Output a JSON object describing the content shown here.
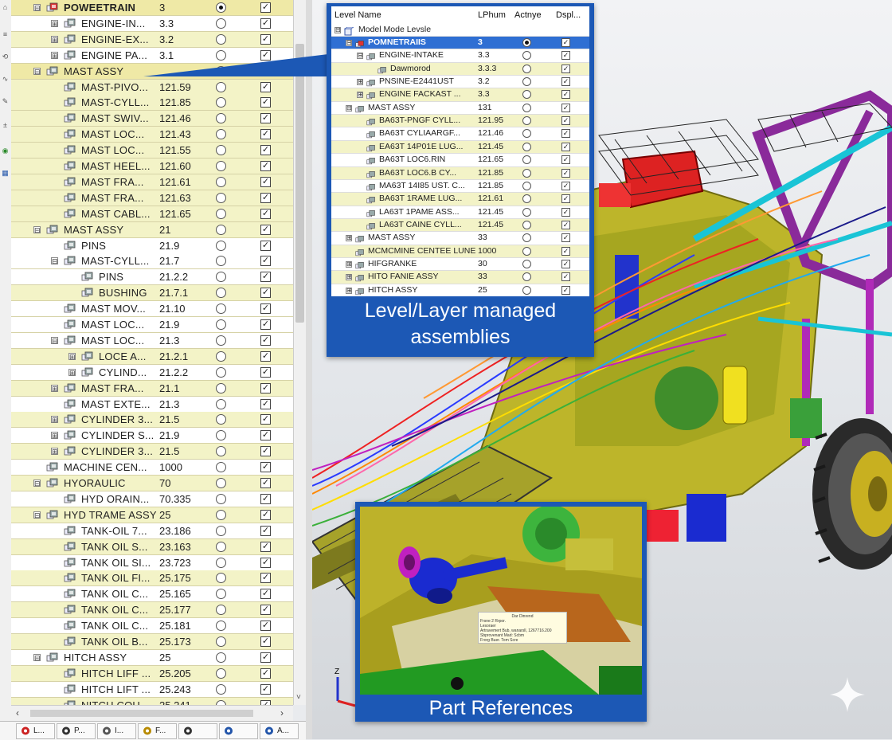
{
  "tree": {
    "rows": [
      {
        "name": "POWEETRAIN",
        "value": "3",
        "indent": 0,
        "toggle": "⊟",
        "active": true,
        "bold": true,
        "style": "top",
        "icon": "assembly-red-icon"
      },
      {
        "name": "ENGINE-IN...",
        "value": "3.3",
        "indent": 1,
        "toggle": "⊞",
        "active": false,
        "style": "nohl",
        "icon": "part-icon"
      },
      {
        "name": "ENGINE-EX...",
        "value": "3.2",
        "indent": 1,
        "toggle": "⊞",
        "active": false,
        "style": "hl",
        "icon": "part-icon"
      },
      {
        "name": "ENGINE PA...",
        "value": "3.1",
        "indent": 1,
        "toggle": "⊞",
        "active": false,
        "style": "nohl",
        "icon": "part-icon"
      },
      {
        "name": "MAST ASSY",
        "value": "",
        "indent": 0,
        "toggle": "⊟",
        "active": false,
        "style": "top",
        "icon": "part-icon"
      },
      {
        "name": "MAST-PIVO...",
        "value": "121.59",
        "indent": 1,
        "toggle": "",
        "active": false,
        "style": "hl",
        "icon": "part-icon"
      },
      {
        "name": "MAST-CYLL...",
        "value": "121.85",
        "indent": 1,
        "toggle": "",
        "active": false,
        "style": "hl",
        "icon": "part-icon"
      },
      {
        "name": "MAST SWIV...",
        "value": "121.46",
        "indent": 1,
        "toggle": "",
        "active": false,
        "style": "hl",
        "icon": "part-icon"
      },
      {
        "name": "MAST LOC...",
        "value": "121.43",
        "indent": 1,
        "toggle": "",
        "active": false,
        "style": "hl",
        "icon": "part-icon"
      },
      {
        "name": "MAST LOC...",
        "value": "121.55",
        "indent": 1,
        "toggle": "",
        "active": false,
        "style": "hl",
        "icon": "part-icon"
      },
      {
        "name": "MAST HEEL...",
        "value": "121.60",
        "indent": 1,
        "toggle": "",
        "active": false,
        "style": "hl",
        "icon": "part-icon"
      },
      {
        "name": "MAST FRA...",
        "value": "121.61",
        "indent": 1,
        "toggle": "",
        "active": false,
        "style": "hl",
        "icon": "part-icon"
      },
      {
        "name": "MAST FRA...",
        "value": "121.63",
        "indent": 1,
        "toggle": "",
        "active": false,
        "style": "hl",
        "icon": "part-icon"
      },
      {
        "name": "MAST CABL...",
        "value": "121.65",
        "indent": 1,
        "toggle": "",
        "active": false,
        "style": "hl",
        "icon": "part-icon"
      },
      {
        "name": "MAST ASSY",
        "value": "21",
        "indent": 0,
        "toggle": "⊟",
        "active": false,
        "style": "hl",
        "icon": "part-icon"
      },
      {
        "name": "PINS",
        "value": "21.9",
        "indent": 1,
        "toggle": "",
        "active": false,
        "style": "nohl",
        "icon": "part-icon"
      },
      {
        "name": "MAST-CYLL...",
        "value": "21.7",
        "indent": 1,
        "toggle": "⊟",
        "active": false,
        "style": "nohl",
        "icon": "part-icon"
      },
      {
        "name": "PINS",
        "value": "21.2.2",
        "indent": 2,
        "toggle": "",
        "active": false,
        "style": "nohl",
        "icon": "part-icon"
      },
      {
        "name": "BUSHING",
        "value": "21.7.1",
        "indent": 2,
        "toggle": "",
        "active": false,
        "style": "hl",
        "icon": "part-icon"
      },
      {
        "name": "MAST MOV...",
        "value": "21.10",
        "indent": 1,
        "toggle": "",
        "active": false,
        "style": "nohl",
        "icon": "part-icon"
      },
      {
        "name": "MAST LOC...",
        "value": "21.9",
        "indent": 1,
        "toggle": "",
        "active": false,
        "style": "nohl",
        "icon": "part-icon"
      },
      {
        "name": "MAST LOC...",
        "value": "21.3",
        "indent": 1,
        "toggle": "⊟",
        "active": false,
        "style": "nohl",
        "icon": "part-icon"
      },
      {
        "name": "LOCE A...",
        "value": "21.2.1",
        "indent": 2,
        "toggle": "⊞",
        "active": false,
        "style": "hl",
        "icon": "part-icon"
      },
      {
        "name": "CYLIND...",
        "value": "21.2.2",
        "indent": 2,
        "toggle": "⊞",
        "active": false,
        "style": "nohl",
        "icon": "part-icon"
      },
      {
        "name": "MAST FRA...",
        "value": "21.1",
        "indent": 1,
        "toggle": "⊞",
        "active": false,
        "style": "hl",
        "icon": "part-icon"
      },
      {
        "name": "MAST EXTE...",
        "value": "21.3",
        "indent": 1,
        "toggle": "",
        "active": false,
        "style": "nohl",
        "icon": "part-icon"
      },
      {
        "name": "CYLINDER 3...",
        "value": "21.5",
        "indent": 1,
        "toggle": "⊞",
        "active": false,
        "style": "hl",
        "icon": "part-icon"
      },
      {
        "name": "CYLINDER S...",
        "value": "21.9",
        "indent": 1,
        "toggle": "⊞",
        "active": false,
        "style": "nohl",
        "icon": "part-icon"
      },
      {
        "name": "CYLINDER 3...",
        "value": "21.5",
        "indent": 1,
        "toggle": "⊞",
        "active": false,
        "style": "hl",
        "icon": "part-icon"
      },
      {
        "name": "MACHINE CEN...",
        "value": "1000",
        "indent": 0,
        "toggle": "",
        "active": false,
        "style": "nohl",
        "icon": "part-icon"
      },
      {
        "name": "HYORAULIC",
        "value": "70",
        "indent": 0,
        "toggle": "⊟",
        "active": false,
        "style": "hl",
        "icon": "part-icon"
      },
      {
        "name": "HYD ORAIN...",
        "value": "70.335",
        "indent": 1,
        "toggle": "",
        "active": false,
        "style": "nohl",
        "icon": "part-icon"
      },
      {
        "name": "HYD TRAME ASSY",
        "value": "25",
        "indent": 0,
        "toggle": "⊟",
        "active": false,
        "style": "hl",
        "icon": "part-icon"
      },
      {
        "name": "TANK-OIL 7...",
        "value": "23.186",
        "indent": 1,
        "toggle": "",
        "active": false,
        "style": "nohl",
        "icon": "part-icon"
      },
      {
        "name": "TANK OIL S...",
        "value": "23.163",
        "indent": 1,
        "toggle": "",
        "active": false,
        "style": "hl",
        "icon": "part-icon"
      },
      {
        "name": "TANK OIL SI...",
        "value": "23.723",
        "indent": 1,
        "toggle": "",
        "active": false,
        "style": "nohl",
        "icon": "part-icon"
      },
      {
        "name": "TANK OIL FI...",
        "value": "25.175",
        "indent": 1,
        "toggle": "",
        "active": false,
        "style": "hl",
        "icon": "part-icon"
      },
      {
        "name": "TANK OIL C...",
        "value": "25.165",
        "indent": 1,
        "toggle": "",
        "active": false,
        "style": "nohl",
        "icon": "part-icon"
      },
      {
        "name": "TANK OIL C...",
        "value": "25.177",
        "indent": 1,
        "toggle": "",
        "active": false,
        "style": "hl",
        "icon": "part-icon"
      },
      {
        "name": "TANK OIL C...",
        "value": "25.181",
        "indent": 1,
        "toggle": "",
        "active": false,
        "style": "nohl",
        "icon": "part-icon"
      },
      {
        "name": "TANK OIL B...",
        "value": "25.173",
        "indent": 1,
        "toggle": "",
        "active": false,
        "style": "hl",
        "icon": "part-icon"
      },
      {
        "name": "HITCH ASSY",
        "value": "25",
        "indent": 0,
        "toggle": "⊟",
        "active": false,
        "style": "nohl",
        "icon": "part-icon"
      },
      {
        "name": "HITCH LIFF ...",
        "value": "25.205",
        "indent": 1,
        "toggle": "",
        "active": false,
        "style": "hl",
        "icon": "part-icon"
      },
      {
        "name": "HITCH LIFT ...",
        "value": "25.243",
        "indent": 1,
        "toggle": "",
        "active": false,
        "style": "nohl",
        "icon": "part-icon"
      },
      {
        "name": "NITCH COU...",
        "value": "25.241",
        "indent": 1,
        "toggle": "",
        "active": false,
        "style": "hl",
        "icon": "part-icon"
      }
    ]
  },
  "tabs": [
    {
      "label": "L...",
      "icon": "layers-icon"
    },
    {
      "label": "P...",
      "icon": "printer-icon"
    },
    {
      "label": "I...",
      "icon": "parts-icon"
    },
    {
      "label": "F...",
      "icon": "lightbulb-icon"
    },
    {
      "label": "",
      "icon": "sphere-icon"
    },
    {
      "label": "",
      "icon": "monitor-icon"
    },
    {
      "label": "A...",
      "icon": "appearance-icon"
    }
  ],
  "callout": {
    "headers": {
      "name": "Level Name",
      "number": "LPhum",
      "active": "Actnye",
      "display": "Dspl..."
    },
    "root": "Model Mode Levsle",
    "rows": [
      {
        "name": "POMNETRAIIS",
        "value": "3",
        "indent": 1,
        "toggle": "⊟",
        "active": true,
        "style": "sel"
      },
      {
        "name": "ENGINE-INTAKE",
        "value": "3.3",
        "indent": 2,
        "toggle": "⊟",
        "active": false,
        "style": "w"
      },
      {
        "name": "Dawmorod",
        "value": "3.3.3",
        "indent": 3,
        "toggle": "",
        "active": false,
        "style": "y"
      },
      {
        "name": "PNSINE-E2441UST",
        "value": "3.2",
        "indent": 2,
        "toggle": "⊞",
        "active": false,
        "style": "w"
      },
      {
        "name": "ENGINE FACKAST ...",
        "value": "3.3",
        "indent": 2,
        "toggle": "⊞",
        "active": false,
        "style": "y"
      },
      {
        "name": "MAST ASSY",
        "value": "131",
        "indent": 1,
        "toggle": "⊟",
        "active": false,
        "style": "w"
      },
      {
        "name": "BA63T-PNGF CYLL...",
        "value": "121.95",
        "indent": 2,
        "toggle": "",
        "active": false,
        "style": "y"
      },
      {
        "name": "BA63T CYLIAARGF...",
        "value": "121.46",
        "indent": 2,
        "toggle": "",
        "active": false,
        "style": "w"
      },
      {
        "name": "EA63T 14P01E LUG...",
        "value": "121.45",
        "indent": 2,
        "toggle": "",
        "active": false,
        "style": "y"
      },
      {
        "name": "BA63T LOC6.RIN",
        "value": "121.65",
        "indent": 2,
        "toggle": "",
        "active": false,
        "style": "w"
      },
      {
        "name": "BA63T LOC6.B CY...",
        "value": "121.85",
        "indent": 2,
        "toggle": "",
        "active": false,
        "style": "y"
      },
      {
        "name": "MA63T 14I85 UST. C...",
        "value": "121.85",
        "indent": 2,
        "toggle": "",
        "active": false,
        "style": "w"
      },
      {
        "name": "BA63T 1RAME LUG...",
        "value": "121.61",
        "indent": 2,
        "toggle": "",
        "active": false,
        "style": "y"
      },
      {
        "name": "LA63T 1PAME ASS...",
        "value": "121.45",
        "indent": 2,
        "toggle": "",
        "active": false,
        "style": "w"
      },
      {
        "name": "LA63T CAINE CYLL...",
        "value": "121.45",
        "indent": 2,
        "toggle": "",
        "active": false,
        "style": "y"
      },
      {
        "name": "MAST ASSY",
        "value": "33",
        "indent": 1,
        "toggle": "⊞",
        "active": false,
        "style": "w"
      },
      {
        "name": "MCMCMINE CENTEE LUNE",
        "value": "1000",
        "indent": 1,
        "toggle": "",
        "active": false,
        "style": "y"
      },
      {
        "name": "HIFGRANKE",
        "value": "30",
        "indent": 1,
        "toggle": "⊞",
        "active": false,
        "style": "w"
      },
      {
        "name": "HITO FANIE ASSY",
        "value": "33",
        "indent": 1,
        "toggle": "⊞",
        "active": false,
        "style": "y"
      },
      {
        "name": "HITCH ASSY",
        "value": "25",
        "indent": 1,
        "toggle": "⊞",
        "active": false,
        "style": "w"
      }
    ],
    "caption": "Level/Layer managed assemblies"
  },
  "partref": {
    "caption": "Part References",
    "tooltip_lines": [
      "Dar Dinrend",
      "Frsne 2 Rrpor.",
      "Lesoraer",
      "Artravemert Bub, wanarsll, 1267716.200",
      "Sbprovenant Mad: Scbm",
      "Frorg Buer. Tom Scre"
    ]
  }
}
